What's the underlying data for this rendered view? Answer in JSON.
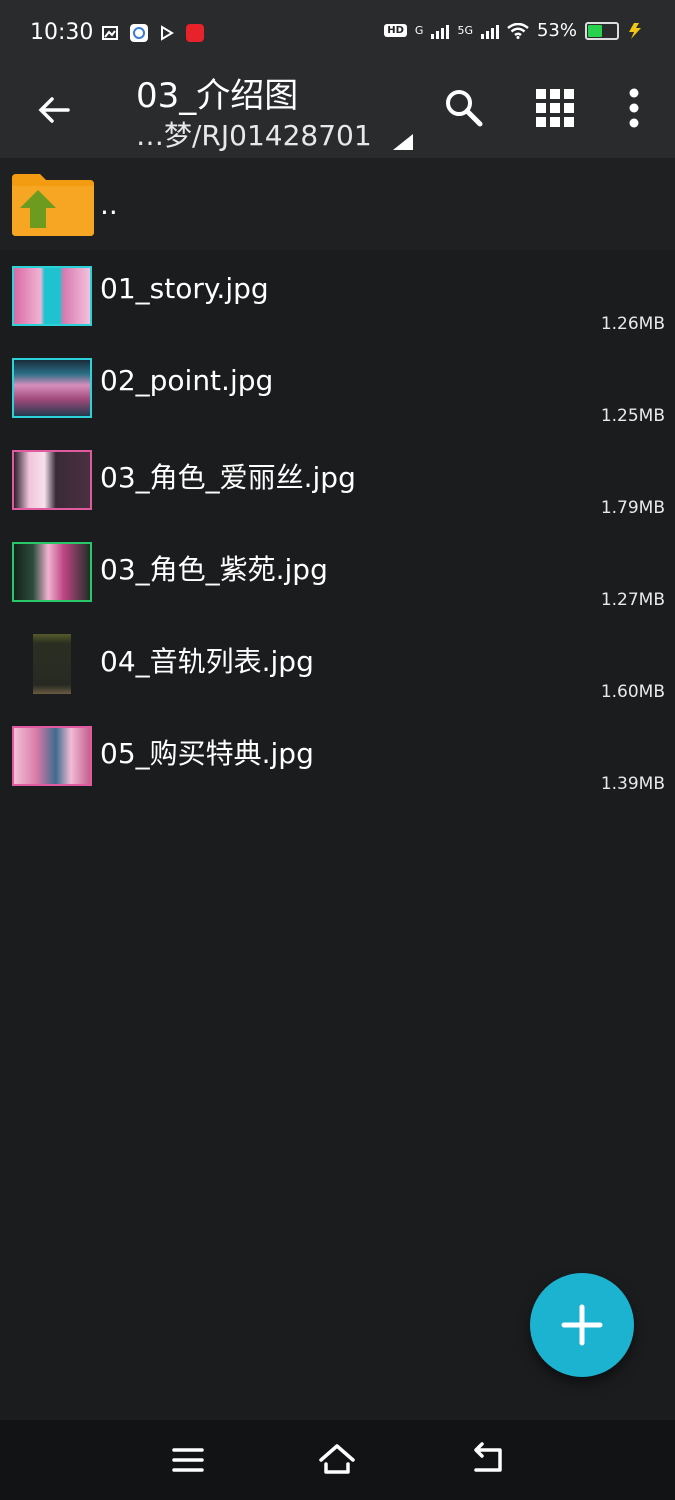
{
  "status": {
    "time": "10:30",
    "network_g": "G",
    "network_5g": "5G",
    "battery": "53%",
    "battery_level": 0.53,
    "battery_color": "#27d14d"
  },
  "toolbar": {
    "title": "03_介绍图",
    "path": "…梦/RJ01428701",
    "icons": [
      "back-arrow-icon",
      "search-icon",
      "grid-view-icon",
      "more-vert-icon"
    ]
  },
  "files": [
    {
      "name": "..",
      "size": "",
      "type": "parent-folder"
    },
    {
      "name": "01_story.jpg",
      "size": "1.26MB",
      "border": "#2bd3d8"
    },
    {
      "name": "02_point.jpg",
      "size": "1.25MB",
      "border": "#2bd3d8"
    },
    {
      "name": "03_角色_爱丽丝.jpg",
      "size": "1.79MB",
      "border": "#e05aa0"
    },
    {
      "name": "03_角色_紫苑.jpg",
      "size": "1.27MB",
      "border": "#27c76a"
    },
    {
      "name": "04_音轨列表.jpg",
      "size": "1.60MB",
      "border": "#1b1c1e"
    },
    {
      "name": "05_购买特典.jpg",
      "size": "1.39MB",
      "border": "#e05aa0"
    }
  ],
  "fab_icon": "plus-icon",
  "nav": {
    "icons": [
      "menu-icon",
      "home-icon",
      "back-icon"
    ]
  },
  "colors": {
    "accent": "#1bb3cf",
    "folder": "#f39c12",
    "folder_arrow": "#6d9b1f"
  }
}
